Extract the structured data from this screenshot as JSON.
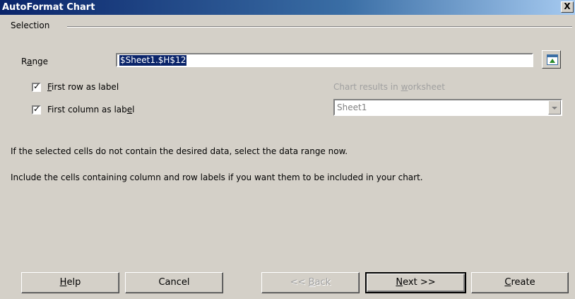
{
  "window": {
    "title": "AutoFormat Chart",
    "close_glyph": "X"
  },
  "selection": {
    "group_label": "Selection",
    "range_label": "Range",
    "range_value": "$Sheet1.$H$12",
    "first_row_label": "First row as label",
    "first_row_checked": true,
    "first_column_label": "First column as label",
    "first_column_checked": true,
    "results_label": "Chart results in worksheet",
    "results_value": "Sheet1"
  },
  "info": {
    "line1": "If the selected cells do not contain the desired data, select the data range now.",
    "line2": "Include the cells containing column and row labels if you want them to be included in your chart."
  },
  "buttons": {
    "help": "Help",
    "cancel": "Cancel",
    "back": "<< Back",
    "next": "Next >>",
    "create": "Create"
  },
  "icons": {
    "shrink": "shrink-range-icon",
    "dropdown": "dropdown-arrow-icon",
    "check": "checkmark-icon"
  }
}
